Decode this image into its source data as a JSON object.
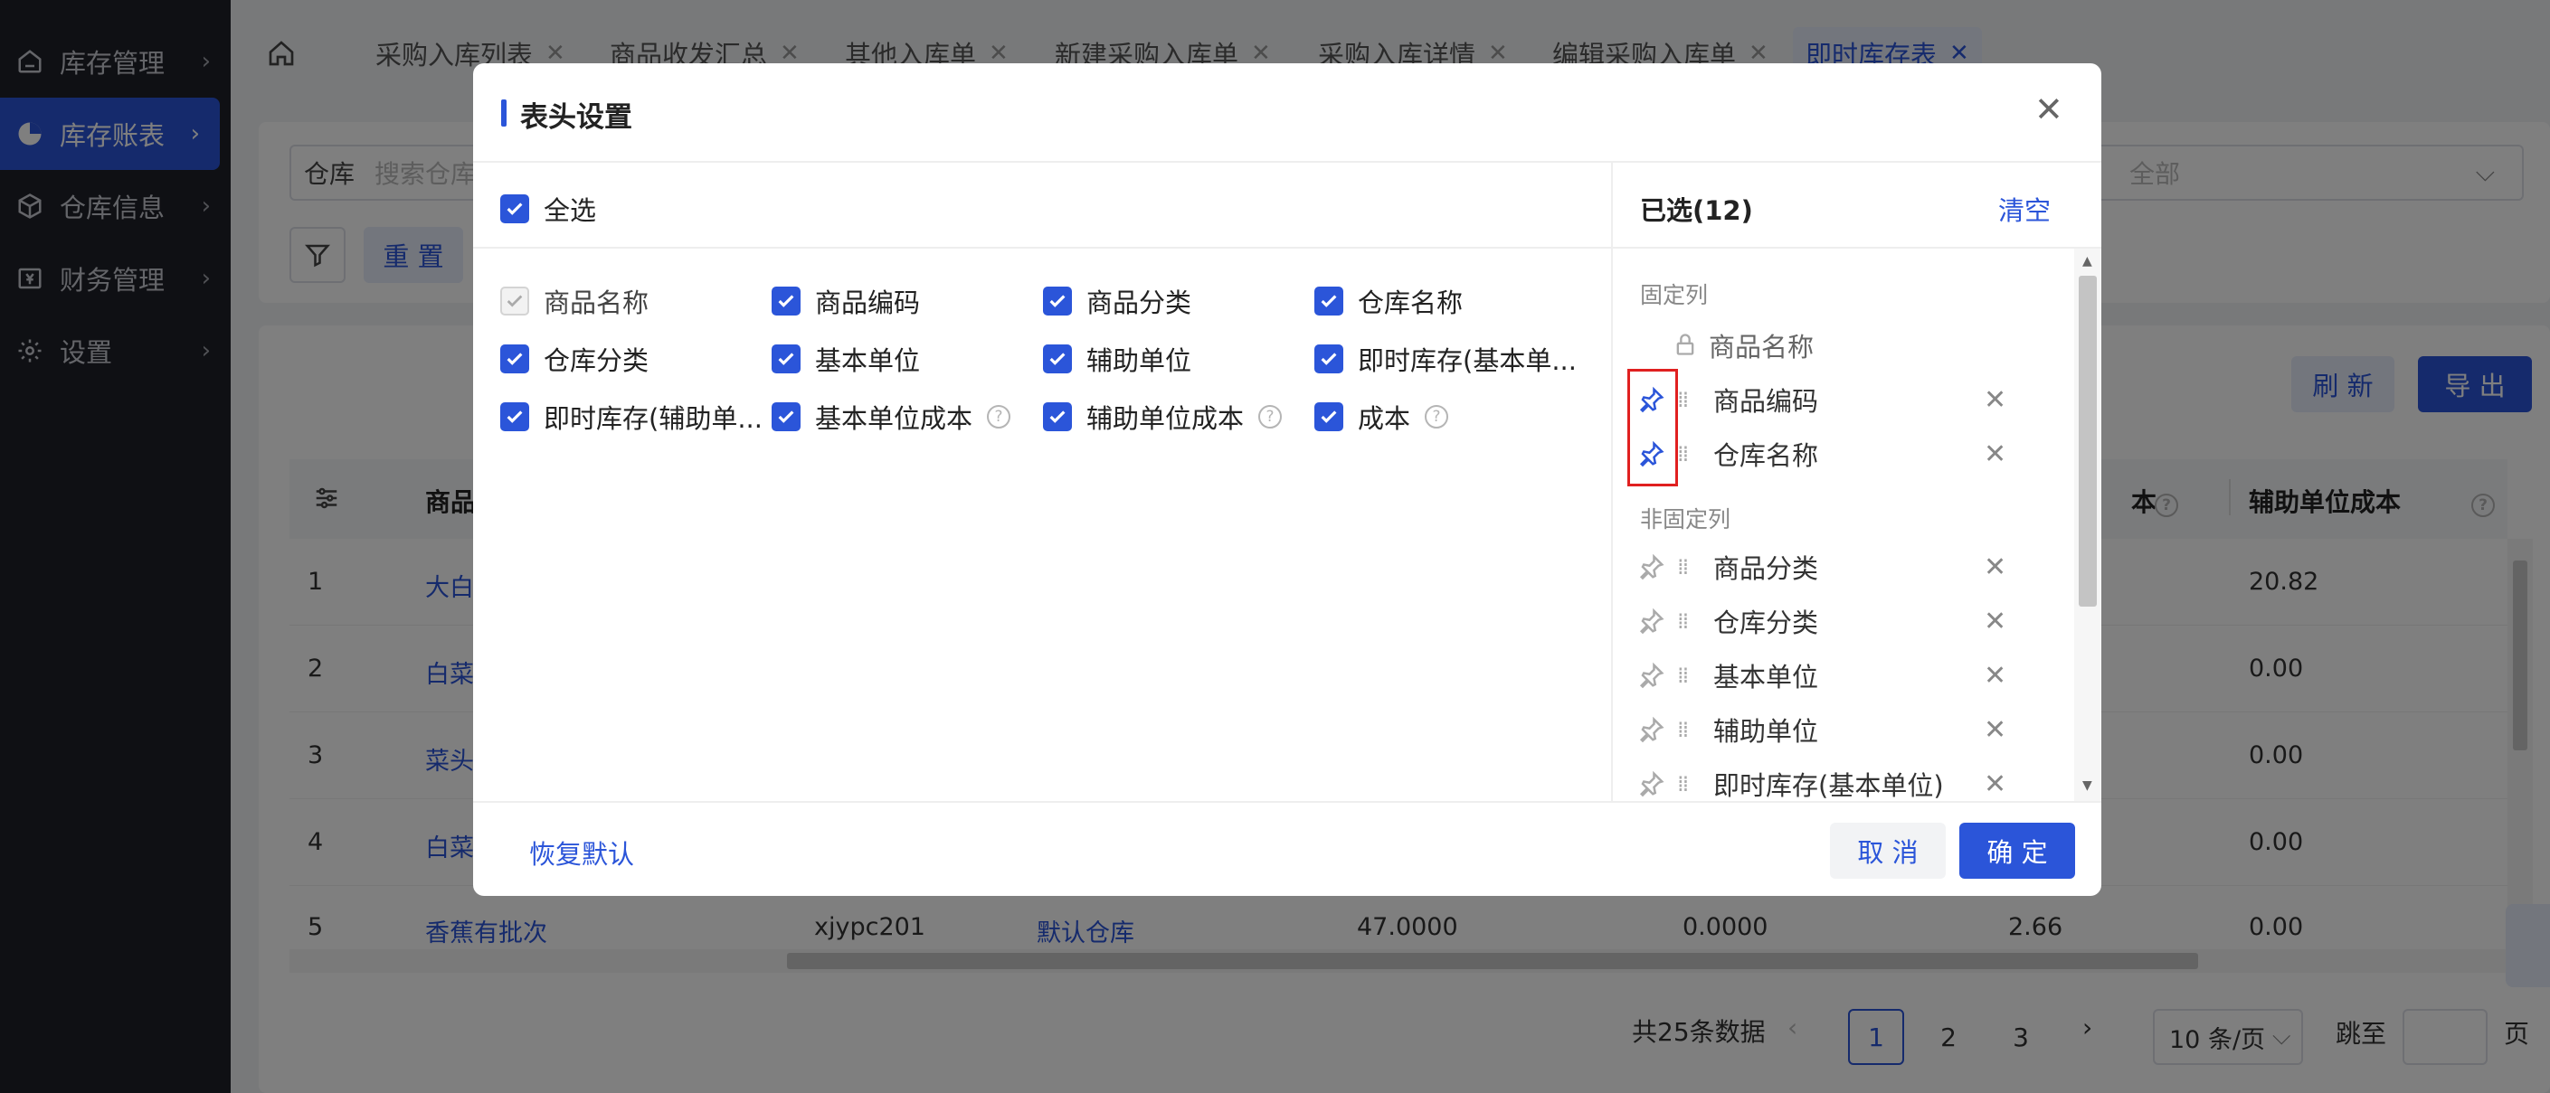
{
  "sidebar": {
    "items": [
      {
        "label": "库存管理",
        "icon": "home-icon",
        "active": false
      },
      {
        "label": "库存账表",
        "icon": "pie-chart-icon",
        "active": true
      },
      {
        "label": "仓库信息",
        "icon": "box-icon",
        "active": false
      },
      {
        "label": "财务管理",
        "icon": "finance-icon",
        "active": false
      },
      {
        "label": "设置",
        "icon": "gear-icon",
        "active": false
      }
    ]
  },
  "tabs": [
    {
      "label": "采购入库列表"
    },
    {
      "label": "商品收发汇总"
    },
    {
      "label": "其他入库单"
    },
    {
      "label": "新建采购入库单"
    },
    {
      "label": "采购入库详情"
    },
    {
      "label": "编辑采购入库单"
    },
    {
      "label": "即时库存表",
      "active": true
    }
  ],
  "filters": {
    "warehouse_label": "仓库",
    "warehouse_placeholder": "搜索仓库",
    "right_select_label": "全部",
    "reset_label": "重 置"
  },
  "toolbar": {
    "refresh_label": "刷 新",
    "export_label": "导 出"
  },
  "table": {
    "headers": [
      "商品",
      "本",
      "辅助单位成本"
    ],
    "rows": [
      {
        "index": "1",
        "name": "大白",
        "code": "",
        "warehouse": "",
        "qty": "",
        "cost": "",
        "unit_cost": "",
        "aux_cost": "20.82"
      },
      {
        "index": "2",
        "name": "白菜",
        "code": "",
        "warehouse": "",
        "qty": "",
        "cost": "",
        "unit_cost": "",
        "aux_cost": "0.00"
      },
      {
        "index": "3",
        "name": "菜头",
        "code": "",
        "warehouse": "",
        "qty": "",
        "cost": "",
        "unit_cost": "",
        "aux_cost": "0.00"
      },
      {
        "index": "4",
        "name": "白菜",
        "code": "",
        "warehouse": "",
        "qty": "",
        "cost": "",
        "unit_cost": "",
        "aux_cost": "0.00"
      },
      {
        "index": "5",
        "name": "香蕉有批次",
        "code": "xjypc201",
        "warehouse": "默认仓库",
        "qty": "47.0000",
        "cost": "0.0000",
        "unit_cost": "2.66",
        "aux_cost": "0.00"
      }
    ]
  },
  "pagination": {
    "total_text": "共25条数据",
    "pages": [
      "1",
      "2",
      "3"
    ],
    "current": "1",
    "page_size": "10 条/页",
    "jump_label": "跳至",
    "page_suffix": "页"
  },
  "modal": {
    "title": "表头设置",
    "select_all_label": "全选",
    "options": [
      {
        "label": "商品名称",
        "disabled": true
      },
      {
        "label": "商品编码"
      },
      {
        "label": "商品分类"
      },
      {
        "label": "仓库名称"
      },
      {
        "label": "仓库分类"
      },
      {
        "label": "基本单位"
      },
      {
        "label": "辅助单位"
      },
      {
        "label": "即时库存(基本单..."
      },
      {
        "label": "即时库存(辅助单..."
      },
      {
        "label": "基本单位成本",
        "help": true
      },
      {
        "label": "辅助单位成本",
        "help": true
      },
      {
        "label": "成本",
        "help": true
      }
    ],
    "selected_title": "已选(12)",
    "clear_label": "清空",
    "fixed_section_label": "固定列",
    "fixed_items": [
      {
        "label": "商品名称",
        "locked": true
      },
      {
        "label": "商品编码",
        "pinned": true
      },
      {
        "label": "仓库名称",
        "pinned": true
      }
    ],
    "nonfixed_section_label": "非固定列",
    "nonfixed_items": [
      {
        "label": "商品分类"
      },
      {
        "label": "仓库分类"
      },
      {
        "label": "基本单位"
      },
      {
        "label": "辅助单位"
      },
      {
        "label": "即时库存(基本单位)"
      }
    ],
    "restore_label": "恢复默认",
    "cancel_label": "取 消",
    "confirm_label": "确 定"
  },
  "colors": {
    "accent": "#2b55d9",
    "sidebar_bg": "#1f2029",
    "highlight": "#e02020"
  }
}
